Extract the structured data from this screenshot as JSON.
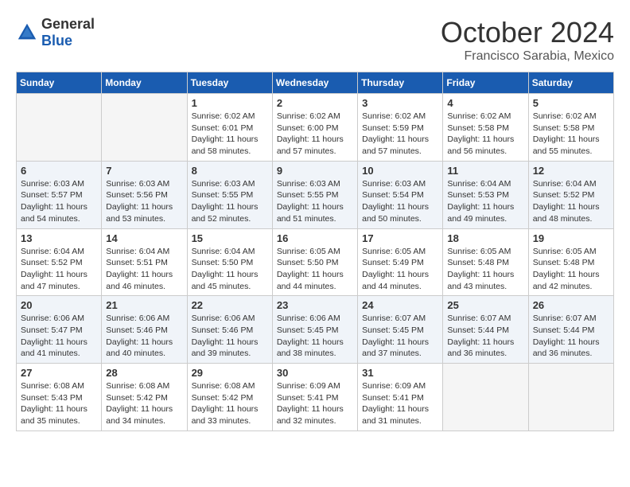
{
  "header": {
    "logo": {
      "general": "General",
      "blue": "Blue"
    },
    "title": "October 2024",
    "subtitle": "Francisco Sarabia, Mexico"
  },
  "calendar": {
    "days_of_week": [
      "Sunday",
      "Monday",
      "Tuesday",
      "Wednesday",
      "Thursday",
      "Friday",
      "Saturday"
    ],
    "weeks": [
      [
        {
          "day": "",
          "info": ""
        },
        {
          "day": "",
          "info": ""
        },
        {
          "day": "1",
          "info": "Sunrise: 6:02 AM\nSunset: 6:01 PM\nDaylight: 11 hours and 58 minutes."
        },
        {
          "day": "2",
          "info": "Sunrise: 6:02 AM\nSunset: 6:00 PM\nDaylight: 11 hours and 57 minutes."
        },
        {
          "day": "3",
          "info": "Sunrise: 6:02 AM\nSunset: 5:59 PM\nDaylight: 11 hours and 57 minutes."
        },
        {
          "day": "4",
          "info": "Sunrise: 6:02 AM\nSunset: 5:58 PM\nDaylight: 11 hours and 56 minutes."
        },
        {
          "day": "5",
          "info": "Sunrise: 6:02 AM\nSunset: 5:58 PM\nDaylight: 11 hours and 55 minutes."
        }
      ],
      [
        {
          "day": "6",
          "info": "Sunrise: 6:03 AM\nSunset: 5:57 PM\nDaylight: 11 hours and 54 minutes."
        },
        {
          "day": "7",
          "info": "Sunrise: 6:03 AM\nSunset: 5:56 PM\nDaylight: 11 hours and 53 minutes."
        },
        {
          "day": "8",
          "info": "Sunrise: 6:03 AM\nSunset: 5:55 PM\nDaylight: 11 hours and 52 minutes."
        },
        {
          "day": "9",
          "info": "Sunrise: 6:03 AM\nSunset: 5:55 PM\nDaylight: 11 hours and 51 minutes."
        },
        {
          "day": "10",
          "info": "Sunrise: 6:03 AM\nSunset: 5:54 PM\nDaylight: 11 hours and 50 minutes."
        },
        {
          "day": "11",
          "info": "Sunrise: 6:04 AM\nSunset: 5:53 PM\nDaylight: 11 hours and 49 minutes."
        },
        {
          "day": "12",
          "info": "Sunrise: 6:04 AM\nSunset: 5:52 PM\nDaylight: 11 hours and 48 minutes."
        }
      ],
      [
        {
          "day": "13",
          "info": "Sunrise: 6:04 AM\nSunset: 5:52 PM\nDaylight: 11 hours and 47 minutes."
        },
        {
          "day": "14",
          "info": "Sunrise: 6:04 AM\nSunset: 5:51 PM\nDaylight: 11 hours and 46 minutes."
        },
        {
          "day": "15",
          "info": "Sunrise: 6:04 AM\nSunset: 5:50 PM\nDaylight: 11 hours and 45 minutes."
        },
        {
          "day": "16",
          "info": "Sunrise: 6:05 AM\nSunset: 5:50 PM\nDaylight: 11 hours and 44 minutes."
        },
        {
          "day": "17",
          "info": "Sunrise: 6:05 AM\nSunset: 5:49 PM\nDaylight: 11 hours and 44 minutes."
        },
        {
          "day": "18",
          "info": "Sunrise: 6:05 AM\nSunset: 5:48 PM\nDaylight: 11 hours and 43 minutes."
        },
        {
          "day": "19",
          "info": "Sunrise: 6:05 AM\nSunset: 5:48 PM\nDaylight: 11 hours and 42 minutes."
        }
      ],
      [
        {
          "day": "20",
          "info": "Sunrise: 6:06 AM\nSunset: 5:47 PM\nDaylight: 11 hours and 41 minutes."
        },
        {
          "day": "21",
          "info": "Sunrise: 6:06 AM\nSunset: 5:46 PM\nDaylight: 11 hours and 40 minutes."
        },
        {
          "day": "22",
          "info": "Sunrise: 6:06 AM\nSunset: 5:46 PM\nDaylight: 11 hours and 39 minutes."
        },
        {
          "day": "23",
          "info": "Sunrise: 6:06 AM\nSunset: 5:45 PM\nDaylight: 11 hours and 38 minutes."
        },
        {
          "day": "24",
          "info": "Sunrise: 6:07 AM\nSunset: 5:45 PM\nDaylight: 11 hours and 37 minutes."
        },
        {
          "day": "25",
          "info": "Sunrise: 6:07 AM\nSunset: 5:44 PM\nDaylight: 11 hours and 36 minutes."
        },
        {
          "day": "26",
          "info": "Sunrise: 6:07 AM\nSunset: 5:44 PM\nDaylight: 11 hours and 36 minutes."
        }
      ],
      [
        {
          "day": "27",
          "info": "Sunrise: 6:08 AM\nSunset: 5:43 PM\nDaylight: 11 hours and 35 minutes."
        },
        {
          "day": "28",
          "info": "Sunrise: 6:08 AM\nSunset: 5:42 PM\nDaylight: 11 hours and 34 minutes."
        },
        {
          "day": "29",
          "info": "Sunrise: 6:08 AM\nSunset: 5:42 PM\nDaylight: 11 hours and 33 minutes."
        },
        {
          "day": "30",
          "info": "Sunrise: 6:09 AM\nSunset: 5:41 PM\nDaylight: 11 hours and 32 minutes."
        },
        {
          "day": "31",
          "info": "Sunrise: 6:09 AM\nSunset: 5:41 PM\nDaylight: 11 hours and 31 minutes."
        },
        {
          "day": "",
          "info": ""
        },
        {
          "day": "",
          "info": ""
        }
      ]
    ]
  }
}
